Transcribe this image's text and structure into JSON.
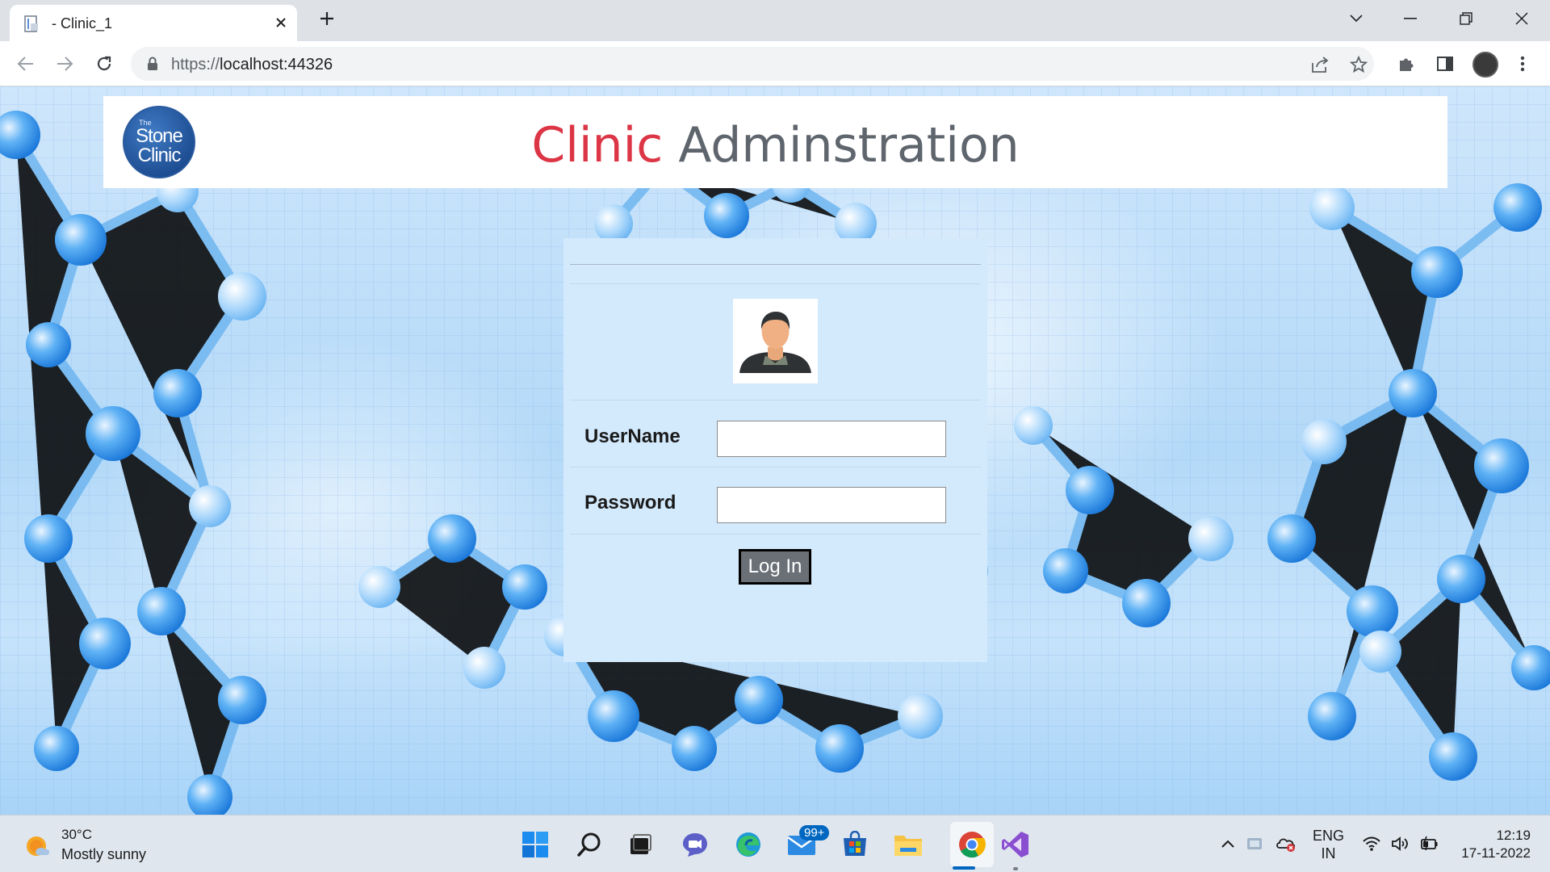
{
  "browser": {
    "tab_title": "- Clinic_1",
    "url_scheme": "https://",
    "url_host": "localhost:44326"
  },
  "page": {
    "title_part1": "Clinic",
    "title_part2": "Adminstration",
    "logo_the": "The",
    "logo_line1": "Stone",
    "logo_line2": "Clinic",
    "username_label": "UserName",
    "password_label": "Password",
    "username_value": "",
    "password_value": "",
    "login_button": "Log In"
  },
  "taskbar": {
    "weather_temp": "30°C",
    "weather_desc": "Mostly sunny",
    "mail_badge": "99+",
    "lang_line1": "ENG",
    "lang_line2": "IN",
    "time": "12:19",
    "date": "17-11-2022"
  },
  "colors": {
    "title_red": "#dc3545",
    "title_grey": "#5f656d",
    "panel_bg": "#d3e9fc",
    "login_btn_bg": "#6b7077"
  }
}
